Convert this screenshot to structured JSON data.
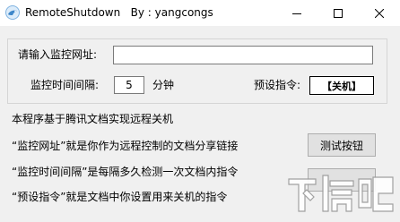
{
  "window": {
    "title": "RemoteShutdown   By : yangcongs",
    "icon": "bird-app-icon",
    "controls": {
      "minimize": "minimize-icon",
      "maximize": "maximize-icon",
      "close": "close-icon"
    }
  },
  "form": {
    "url_label": "请输入监控网址:",
    "url_value": "",
    "interval_label": "监控时间间隔:",
    "interval_value": "5",
    "interval_unit": "分钟",
    "command_label": "预设指令:",
    "command_value": "【关机】"
  },
  "description": [
    "本程序基于腾讯文档实现远程关机",
    "“监控网址”就是你作为远程控制的文档分享链接",
    "“监控时间间隔”是每隔多久检测一次文档内指令",
    "“预设指令”就是文档中你设置用来关机的指令"
  ],
  "buttons": {
    "test_label": "测试按钮",
    "second_label": ""
  },
  "watermark": {
    "text": "下载吧",
    "icon": "download-logo-icon"
  }
}
